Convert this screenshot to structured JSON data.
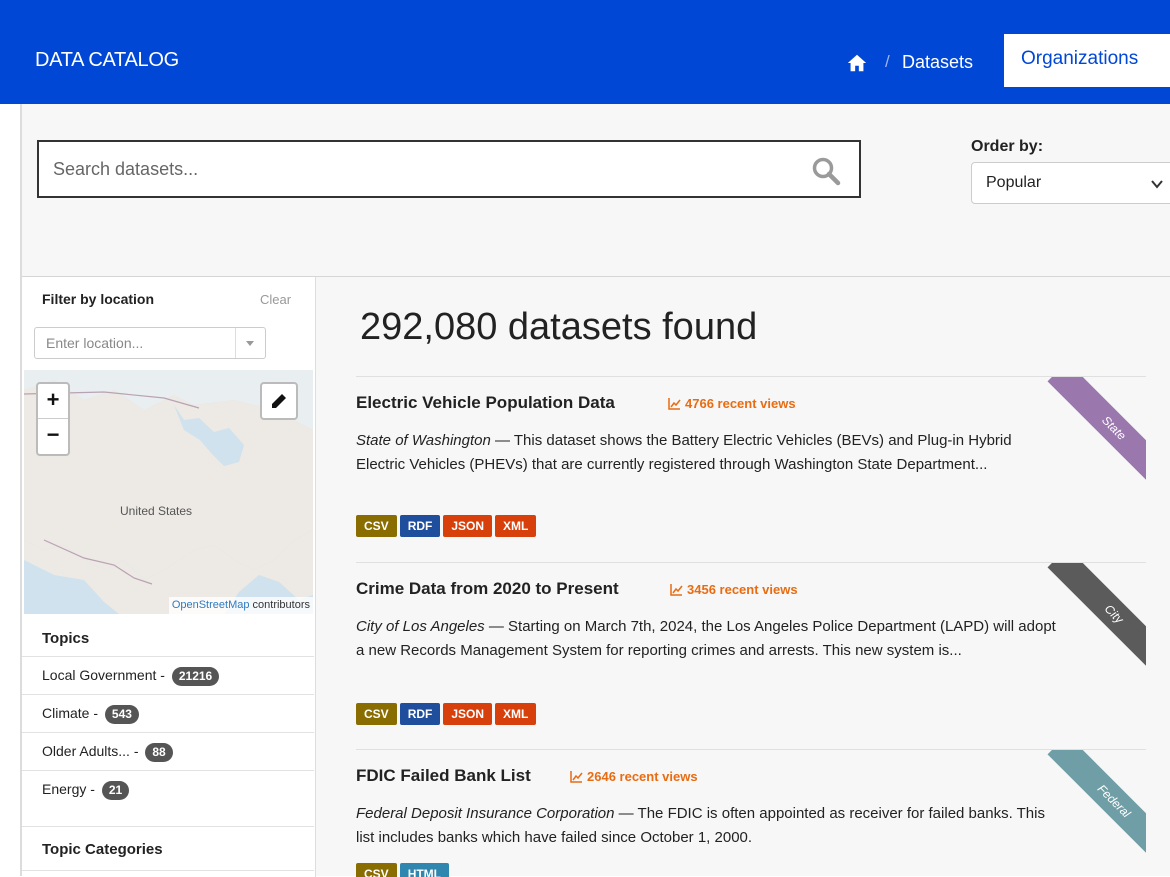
{
  "header": {
    "brand": "DATA CATALOG",
    "breadcrumb_sep": "/",
    "breadcrumb_current": "Datasets",
    "org_tab": "Organizations"
  },
  "search": {
    "placeholder": "Search datasets..."
  },
  "order": {
    "label": "Order by:",
    "selected": "Popular"
  },
  "sidebar": {
    "filter_title": "Filter by location",
    "clear": "Clear",
    "location_placeholder": "Enter location...",
    "map_label": "United States",
    "map_credit_link": "OpenStreetMap",
    "map_credit_rest": " contributors",
    "zoom_in": "+",
    "zoom_out": "−",
    "topics_title": "Topics",
    "topics": [
      {
        "label": "Local Government - ",
        "count": "21216"
      },
      {
        "label": "Climate - ",
        "count": "543"
      },
      {
        "label": "Older Adults... - ",
        "count": "88"
      },
      {
        "label": "Energy - ",
        "count": "21"
      }
    ],
    "topic_categories_title": "Topic Categories"
  },
  "results": {
    "count_text": "292,080 datasets found",
    "datasets": [
      {
        "title": "Electric Vehicle Population Data",
        "views": "4766 recent views",
        "org": "State of Washington",
        "desc": " — This dataset shows the Battery Electric Vehicles (BEVs) and Plug-in Hybrid Electric Vehicles (PHEVs) that are currently registered through Washington State Department...",
        "formats": [
          "CSV",
          "RDF",
          "JSON",
          "XML"
        ],
        "ribbon": "State",
        "ribbon_color": "#9a77ad"
      },
      {
        "title": "Crime Data from 2020 to Present",
        "views": "3456 recent views",
        "org": "City of Los Angeles",
        "desc": " — Starting on March 7th, 2024, the Los Angeles Police Department (LAPD) will adopt a new Records Management System for reporting crimes and arrests. This new system is...",
        "formats": [
          "CSV",
          "RDF",
          "JSON",
          "XML"
        ],
        "ribbon": "City",
        "ribbon_color": "#5b5b5b"
      },
      {
        "title": "FDIC Failed Bank List",
        "views": "2646 recent views",
        "org": "Federal Deposit Insurance Corporation",
        "desc": " — The FDIC is often appointed as receiver for failed banks. This list includes banks which have failed since October 1, 2000.",
        "formats": [
          "CSV",
          "HTML"
        ],
        "ribbon": "Federal",
        "ribbon_color": "#6f9ea6"
      }
    ]
  },
  "colors": {
    "brand_blue": "#0047d6",
    "views_orange": "#e86c12"
  },
  "icons": {
    "home": "home-icon",
    "search": "search-icon",
    "chevron": "chevron-down-icon",
    "pencil": "pencil-icon",
    "trend": "trend-chart-icon"
  }
}
